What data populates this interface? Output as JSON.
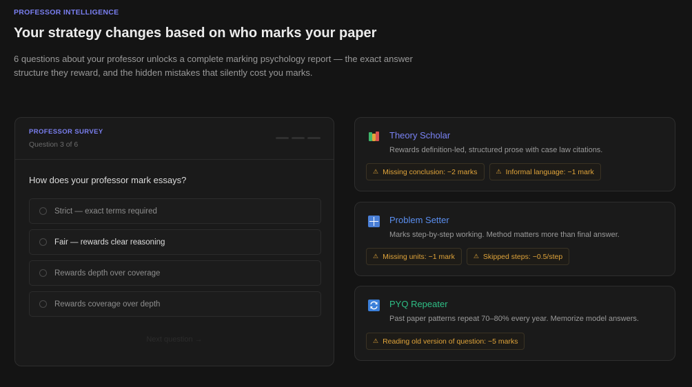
{
  "header": {
    "eyebrow": "PROFESSOR INTELLIGENCE",
    "title": "Your strategy changes based on who marks your paper",
    "lead": "6 questions about your professor unlocks a complete marking psychology report — the exact answer structure they reward, and the hidden mistakes that silently cost you marks."
  },
  "survey": {
    "label": "PROFESSOR SURVEY",
    "step": "Question 3 of 6",
    "progress_segments": 3,
    "question": "How does your professor mark essays?",
    "options": [
      {
        "label": "Strict — exact terms required"
      },
      {
        "label": "Fair — rewards clear reasoning"
      },
      {
        "label": "Rewards depth over coverage"
      },
      {
        "label": "Rewards coverage over depth"
      }
    ],
    "next_label": "Next question →"
  },
  "types": [
    {
      "icon": "books-icon",
      "name": "Theory Scholar",
      "color": "#7a83f5",
      "description": "Rewards definition-led, structured prose with case law citations.",
      "warnings": [
        "Missing conclusion: −2 marks",
        "Informal language: −1 mark"
      ]
    },
    {
      "icon": "numbers-icon",
      "name": "Problem Setter",
      "color": "#5b8ff0",
      "description": "Marks step-by-step working. Method matters more than final answer.",
      "warnings": [
        "Missing units: −1 mark",
        "Skipped steps: −0.5/step"
      ]
    },
    {
      "icon": "repeat-icon",
      "name": "PYQ Repeater",
      "color": "#2fbf86",
      "description": "Past paper patterns repeat 70–80% every year. Memorize model answers.",
      "warnings": [
        "Reading old version of question: −5 marks"
      ]
    }
  ],
  "colors": {
    "accent": "#7a7ff0",
    "warning": "#e0a43a",
    "background": "#141414"
  }
}
